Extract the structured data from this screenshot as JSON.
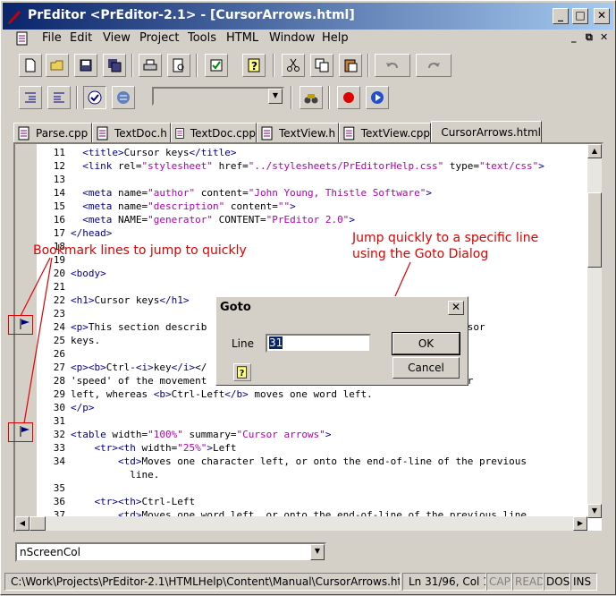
{
  "window": {
    "title": "PrEditor <PrEditor-2.1> - [CursorArrows.html]",
    "caption_buttons": [
      "_",
      "□",
      "✕"
    ]
  },
  "menu": {
    "items": [
      "File",
      "Edit",
      "View",
      "Project",
      "Tools",
      "HTML",
      "Window",
      "Help"
    ],
    "mdi_controls": [
      "_",
      "⧉",
      "✕"
    ]
  },
  "toolbar1": {
    "icons": [
      "new-file-icon",
      "open-folder-icon",
      "save-icon",
      "save-all-icon",
      "print-icon",
      "print-preview-icon",
      "properties-icon",
      "help-icon",
      "cut-icon",
      "copy-icon",
      "paste-icon",
      "undo-icon",
      "redo-icon"
    ]
  },
  "toolbar2": {
    "icons": [
      "outdent-icon",
      "indent-icon",
      "check-icon",
      "list-icon",
      "binoculars-icon",
      "record-icon",
      "play-icon"
    ],
    "combo_value": ""
  },
  "tabs": [
    {
      "label": "Parse.cpp",
      "active": false
    },
    {
      "label": "TextDoc.h",
      "active": false
    },
    {
      "label": "TextDoc.cpp",
      "active": false
    },
    {
      "label": "TextView.h",
      "active": false
    },
    {
      "label": "TextView.cpp",
      "active": false
    },
    {
      "label": "CursorArrows.html",
      "active": true
    }
  ],
  "code_lines": [
    {
      "n": "11",
      "t": "  <title>Cursor keys</title>"
    },
    {
      "n": "12",
      "t": "  <link rel=\"stylesheet\" href=\"../stylesheets/PrEditorHelp.css\" type=\"text/css\">"
    },
    {
      "n": "13",
      "t": ""
    },
    {
      "n": "14",
      "t": "  <meta name=\"author\" content=\"John Young, Thistle Software\">"
    },
    {
      "n": "15",
      "t": "  <meta name=\"description\" content=\"\">"
    },
    {
      "n": "16",
      "t": "  <meta NAME=\"generator\" CONTENT=\"PrEditor 2.0\">"
    },
    {
      "n": "17",
      "t": "</head>"
    },
    {
      "n": "18",
      "t": ""
    },
    {
      "n": "19",
      "t": ""
    },
    {
      "n": "20",
      "t": "<body>"
    },
    {
      "n": "21",
      "t": ""
    },
    {
      "n": "22",
      "t": "<h1>Cursor keys</h1>"
    },
    {
      "n": "23",
      "t": ""
    },
    {
      "n": "24",
      "t": "<p>This section describ                               using the cursor"
    },
    {
      "n": "25",
      "t": "keys."
    },
    {
      "n": "26",
      "t": ""
    },
    {
      "n": "27",
      "t": "<p><b>Ctrl-<i>key</i></                               increases the"
    },
    {
      "n": "28",
      "t": "'speed' of the movement                               s on character"
    },
    {
      "n": "29",
      "t": "left, whereas <b>Ctrl-Left</b> moves one word left."
    },
    {
      "n": "30",
      "t": "</p>"
    },
    {
      "n": "31",
      "t": ""
    },
    {
      "n": "32",
      "t": "<table width=\"100%\" summary=\"Cursor arrows\">"
    },
    {
      "n": "33",
      "t": "    <tr><th width=\"25%\">Left"
    },
    {
      "n": "34",
      "t": "        <td>Moves one character left, or onto the end-of-line of the previous"
    },
    {
      "n": "",
      "t": "          line."
    },
    {
      "n": "35",
      "t": ""
    },
    {
      "n": "36",
      "t": "    <tr><th>Ctrl-Left"
    },
    {
      "n": "37",
      "t": "        <td>Moves one word left, or onto the end-of-line of the previous line."
    }
  ],
  "annotations": {
    "bookmark_note": "Bookmark lines to jump to quickly",
    "goto_note_line1": "Jump quickly to a specific line",
    "goto_note_line2": "using the Goto Dialog"
  },
  "goto_dialog": {
    "title": "Goto",
    "line_label": "Line",
    "line_value": "31",
    "ok_label": "OK",
    "cancel_label": "Cancel"
  },
  "function_combo": {
    "value": "nScreenCol"
  },
  "status": {
    "path": "C:\\Work\\Projects\\PrEditor-2.1\\HTMLHelp\\Content\\Manual\\CursorArrows.html",
    "position": "Ln 31/96, Col 1",
    "cap": "CAP",
    "read": "READ",
    "dos": "DOS",
    "ins": "INS"
  },
  "colors": {
    "title_start": "#0a246a",
    "title_end": "#a6caf0",
    "tag": "#00008b",
    "value": "#b000b0",
    "annotation": "#e00000"
  }
}
